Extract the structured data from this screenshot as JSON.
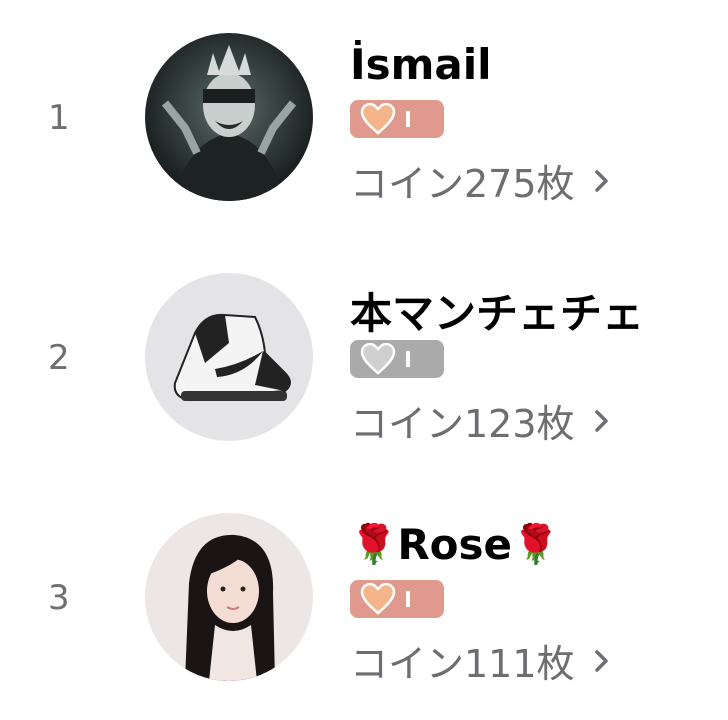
{
  "ranking": [
    {
      "rank": "1",
      "avatar": "dark-crowned-figure-avatar",
      "name_prefix": "",
      "name": "İsmail",
      "name_suffix": "",
      "badge_color": "#e0998d",
      "heart_color": "#f4b48a",
      "level_mark": "I",
      "coins_text": "コイン275枚"
    },
    {
      "rank": "2",
      "avatar": "sneaker-avatar",
      "name_prefix": "",
      "name": "本マンチェチェ",
      "name_suffix": "",
      "badge_color": "#aaaaaa",
      "heart_color": "#cfcfcf",
      "level_mark": "I",
      "coins_text": "コイン123枚"
    },
    {
      "rank": "3",
      "avatar": "woman-portrait-avatar",
      "name_prefix": "🌹",
      "name": "Rose",
      "name_suffix": "🌹",
      "badge_color": "#e0998d",
      "heart_color": "#f4b48a",
      "level_mark": "I",
      "coins_text": "コイン111枚"
    }
  ]
}
